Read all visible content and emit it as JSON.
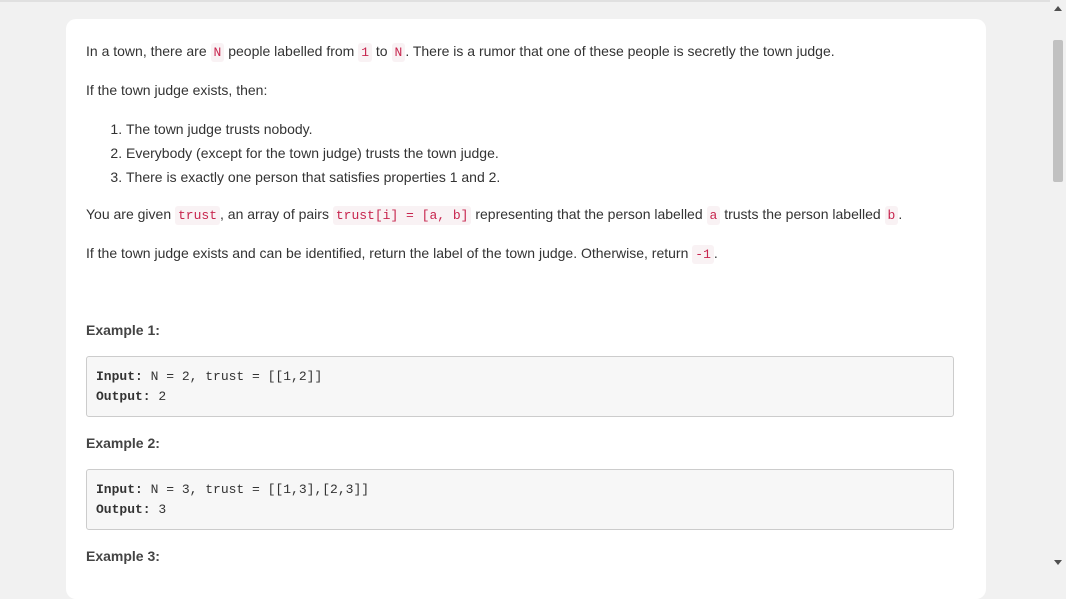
{
  "problem": {
    "intro": {
      "t1": "In a town, there are ",
      "c1": "N",
      "t2": " people labelled from ",
      "c2": "1",
      "t3": " to ",
      "c3": "N",
      "t4": ".  There is a rumor that one of these people is secretly the town judge."
    },
    "condition_lead": "If the town judge exists, then:",
    "conditions": [
      "The town judge trusts nobody.",
      "Everybody (except for the town judge) trusts the town judge.",
      "There is exactly one person that satisfies properties 1 and 2."
    ],
    "given": {
      "t1": "You are given ",
      "c1": "trust",
      "t2": ", an array of pairs ",
      "c2": "trust[i] = [a, b]",
      "t3": " representing that the person labelled ",
      "c3": "a",
      "t4": " trusts the person labelled ",
      "c4": "b",
      "t5": "."
    },
    "ret": {
      "t1": "If the town judge exists and can be identified, return the label of the town judge.  Otherwise, return ",
      "c1": "-1",
      "t2": "."
    }
  },
  "examples": [
    {
      "title": "Example 1:",
      "input_label": "Input:",
      "input": " N = 2, trust = [[1,2]]",
      "output_label": "Output:",
      "output": " 2"
    },
    {
      "title": "Example 2:",
      "input_label": "Input:",
      "input": " N = 3, trust = [[1,3],[2,3]]",
      "output_label": "Output:",
      "output": " 3"
    },
    {
      "title": "Example 3:"
    }
  ]
}
